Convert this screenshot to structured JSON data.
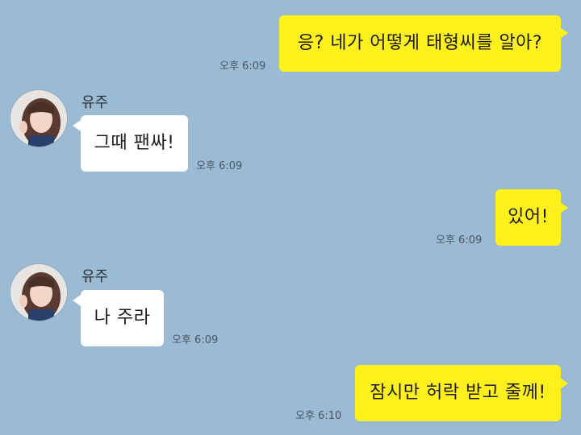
{
  "messages": [
    {
      "direction": "out",
      "text": "응? 네가 어떻게 태형씨를 알아?",
      "time": "오후 6:09"
    },
    {
      "direction": "in",
      "sender": "유주",
      "text": "그때 팬싸!",
      "time": "오후 6:09"
    },
    {
      "direction": "out",
      "text": "있어!",
      "time": "오후 6:09"
    },
    {
      "direction": "in",
      "sender": "유주",
      "text": "나 주라",
      "time": "오후 6:09"
    },
    {
      "direction": "out",
      "text": "잠시만 허락 받고 줄께!",
      "time": "오후 6:10"
    }
  ],
  "colors": {
    "background": "#9bbbd4",
    "outgoing_bubble": "#fef01b",
    "incoming_bubble": "#ffffff"
  },
  "icons": {
    "avatar": "profile-photo-avatar"
  }
}
